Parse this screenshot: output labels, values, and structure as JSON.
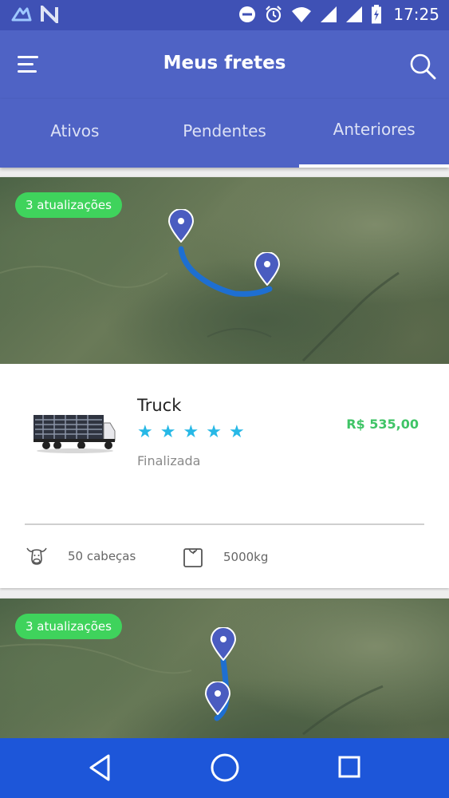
{
  "status_bar": {
    "time": "17:25",
    "icons": [
      "app-notification-icon",
      "n-notification-icon",
      "do-not-disturb-icon",
      "alarm-icon",
      "wifi-icon",
      "signal-icon",
      "signal-icon",
      "battery-charging-icon"
    ]
  },
  "app_bar": {
    "title": "Meus fretes",
    "menu_icon": "menu-icon",
    "search_icon": "search-icon"
  },
  "tabs": [
    {
      "label": "Ativos",
      "active": false
    },
    {
      "label": "Pendentes",
      "active": false
    },
    {
      "label": "Anteriores",
      "active": true
    }
  ],
  "freights": [
    {
      "updates_badge": "3 atualizações",
      "vehicle": "Truck",
      "rating": 5,
      "status": "Finalizada",
      "price": "R$ 535,00",
      "heads": "50 cabeças",
      "weight": "5000kg"
    },
    {
      "updates_badge": "3 atualizações"
    }
  ],
  "colors": {
    "primary": "#4f63c5",
    "status_bar": "#3f51b5",
    "nav_bar": "#1d56d9",
    "badge": "#3fd35c",
    "price": "#3fc466",
    "stars": "#27b8e6",
    "route": "#1e6fd1",
    "pin": "#4a5cc0"
  }
}
